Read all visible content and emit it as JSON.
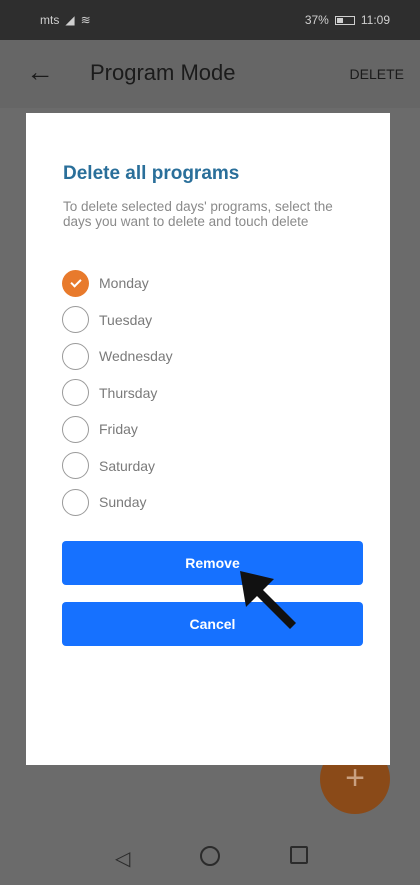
{
  "status_bar": {
    "carrier": "mts",
    "battery_percent": "37%",
    "battery_level": 0.37,
    "time": "11:09"
  },
  "app_bar": {
    "title": "Program Mode",
    "action": "DELETE"
  },
  "fab": {
    "label": "+"
  },
  "dialog": {
    "title": "Delete all programs",
    "description": "To delete selected days' programs, select the days you want to delete and touch delete",
    "days": [
      {
        "label": "Monday",
        "checked": true
      },
      {
        "label": "Tuesday",
        "checked": false
      },
      {
        "label": "Wednesday",
        "checked": false
      },
      {
        "label": "Thursday",
        "checked": false
      },
      {
        "label": "Friday",
        "checked": false
      },
      {
        "label": "Saturday",
        "checked": false
      },
      {
        "label": "Sunday",
        "checked": false
      }
    ],
    "remove_label": "Remove",
    "cancel_label": "Cancel"
  },
  "colors": {
    "accent": "#e87a2c",
    "primary": "#1671ff",
    "title": "#2a6f9a"
  }
}
